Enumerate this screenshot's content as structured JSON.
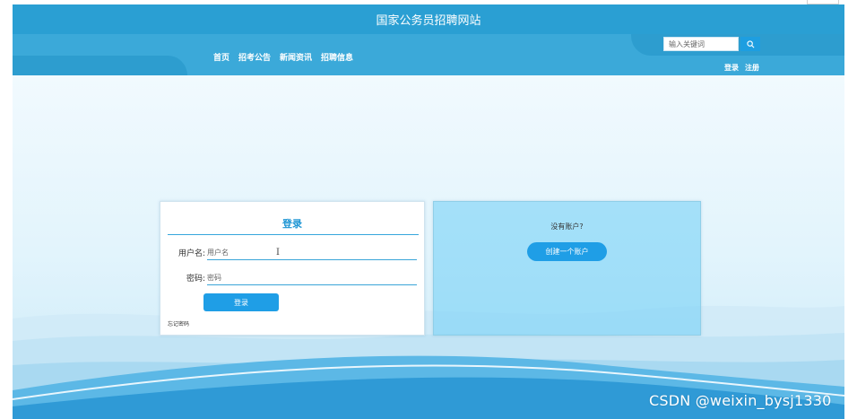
{
  "site": {
    "title": "国家公务员招聘网站"
  },
  "nav": {
    "items": [
      "首页",
      "招考公告",
      "新闻资讯",
      "招聘信息"
    ]
  },
  "search": {
    "placeholder": "输入关键词"
  },
  "user_links": {
    "login": "登录",
    "register": "注册"
  },
  "login_form": {
    "title": "登录",
    "username_label": "用户名:",
    "username_placeholder": "用户名",
    "password_label": "密码:",
    "password_placeholder": "密码",
    "submit_label": "登录",
    "forgot_label": "忘记密码"
  },
  "register_panel": {
    "prompt": "没有账户?",
    "button_label": "创建一个账户"
  },
  "watermark": "CSDN @weixin_bysj1330",
  "colors": {
    "topbar": "#2a9fd3",
    "navbar": "#3ba9d9",
    "accent": "#1f9ee6",
    "register_bg": "#6ecdf5"
  }
}
